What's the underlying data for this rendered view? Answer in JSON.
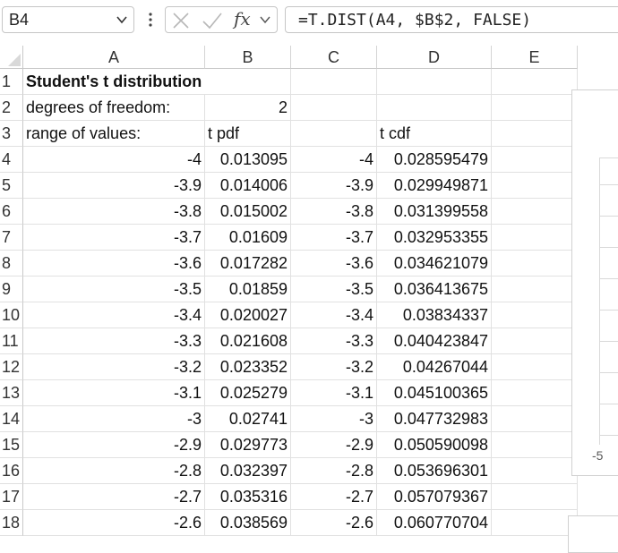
{
  "formula_bar": {
    "name_box": "B4",
    "fx_label": "fx",
    "formula": "=T.DIST(A4, $B$2, FALSE)"
  },
  "columns": [
    "A",
    "B",
    "C",
    "D",
    "E"
  ],
  "rows": [
    {
      "num": "1",
      "A": "Student's t distribution",
      "B": "",
      "C": "",
      "D": ""
    },
    {
      "num": "2",
      "A": "degrees of freedom:",
      "B": "2",
      "C": "",
      "D": ""
    },
    {
      "num": "3",
      "A": "range of values:",
      "B": "t pdf",
      "C": "",
      "D": "t cdf"
    },
    {
      "num": "4",
      "A": "-4",
      "B": "0.013095",
      "C": "-4",
      "D": "0.028595479"
    },
    {
      "num": "5",
      "A": "-3.9",
      "B": "0.014006",
      "C": "-3.9",
      "D": "0.029949871"
    },
    {
      "num": "6",
      "A": "-3.8",
      "B": "0.015002",
      "C": "-3.8",
      "D": "0.031399558"
    },
    {
      "num": "7",
      "A": "-3.7",
      "B": "0.01609",
      "C": "-3.7",
      "D": "0.032953355"
    },
    {
      "num": "8",
      "A": "-3.6",
      "B": "0.017282",
      "C": "-3.6",
      "D": "0.034621079"
    },
    {
      "num": "9",
      "A": "-3.5",
      "B": "0.01859",
      "C": "-3.5",
      "D": "0.036413675"
    },
    {
      "num": "10",
      "A": "-3.4",
      "B": "0.020027",
      "C": "-3.4",
      "D": "0.03834337"
    },
    {
      "num": "11",
      "A": "-3.3",
      "B": "0.021608",
      "C": "-3.3",
      "D": "0.040423847"
    },
    {
      "num": "12",
      "A": "-3.2",
      "B": "0.023352",
      "C": "-3.2",
      "D": "0.04267044"
    },
    {
      "num": "13",
      "A": "-3.1",
      "B": "0.025279",
      "C": "-3.1",
      "D": "0.045100365"
    },
    {
      "num": "14",
      "A": "-3",
      "B": "0.02741",
      "C": "-3",
      "D": "0.047732983"
    },
    {
      "num": "15",
      "A": "-2.9",
      "B": "0.029773",
      "C": "-2.9",
      "D": "0.050590098"
    },
    {
      "num": "16",
      "A": "-2.8",
      "B": "0.032397",
      "C": "-2.8",
      "D": "0.053696301"
    },
    {
      "num": "17",
      "A": "-2.7",
      "B": "0.035316",
      "C": "-2.7",
      "D": "0.057079367"
    },
    {
      "num": "18",
      "A": "-2.6",
      "B": "0.038569",
      "C": "-2.6",
      "D": "0.060770704"
    }
  ],
  "chart": {
    "axis_tick": "-5"
  },
  "selected_cell": "B4",
  "colors": {
    "grid_line": "#e1e1e1",
    "header_border": "#c8c8c8"
  }
}
